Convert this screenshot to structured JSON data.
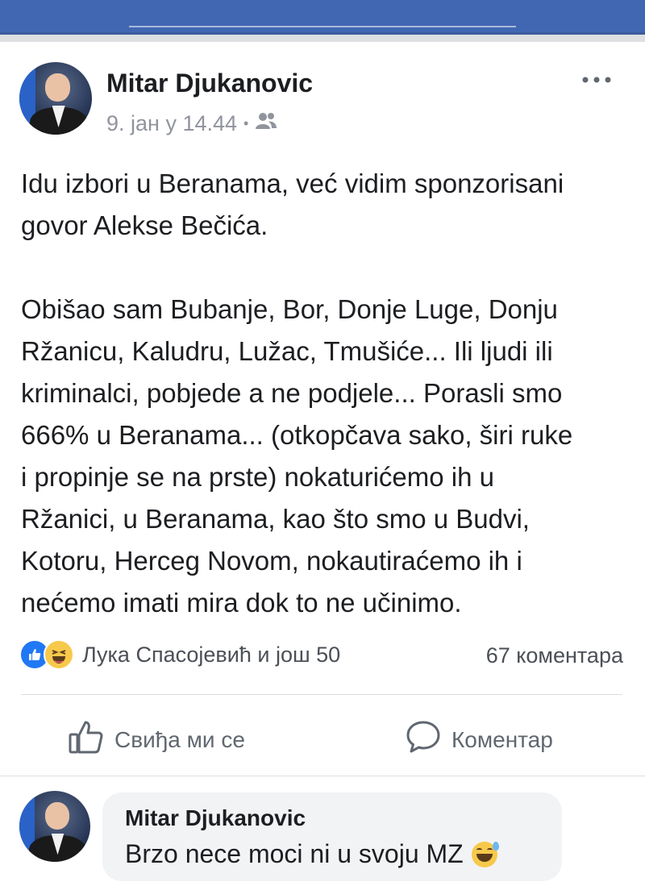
{
  "post": {
    "author": "Mitar Djukanovic",
    "timestamp": "9. јан у 14.44",
    "audience_icon": "friends-icon",
    "menu_icon": "more-dots-icon",
    "text": "Idu izbori u Beranama, već vidim sponzorisani\ngovor Alekse Bečića.\n\nObišao sam Bubanje, Bor, Donje Luge, Donju\nRžanicu, Kaludru, Lužac,  Tmušiće... Ili ljudi ili\nkriminalci, pobjede a ne podjele... Porasli smo\n666% u Beranama... (otkopčava sako, širi ruke\ni propinje se na prste) nokaturićemo ih u\nRžanici, u Beranama, kao što smo u Budvi,\nKotoru, Herceg Novom, nokautiraćemo ih i\nnećemo imati mira dok to ne učinimo."
  },
  "reactions": {
    "icons": [
      "like-reaction-icon",
      "haha-reaction-icon"
    ],
    "summary": "Лука Спасојевић и још 50",
    "comments_count": "67 коментара"
  },
  "actions": {
    "like_label": "Свиђа ми се",
    "comment_label": "Коментар"
  },
  "comment": {
    "author": "Mitar Djukanovic",
    "text": "Brzo nece moci ni u svoju MZ",
    "emoji": "grinning-sweat-emoji"
  },
  "colors": {
    "header_blue": "#4267b2",
    "like_blue": "#2078f4",
    "secondary_text": "#90949c"
  }
}
